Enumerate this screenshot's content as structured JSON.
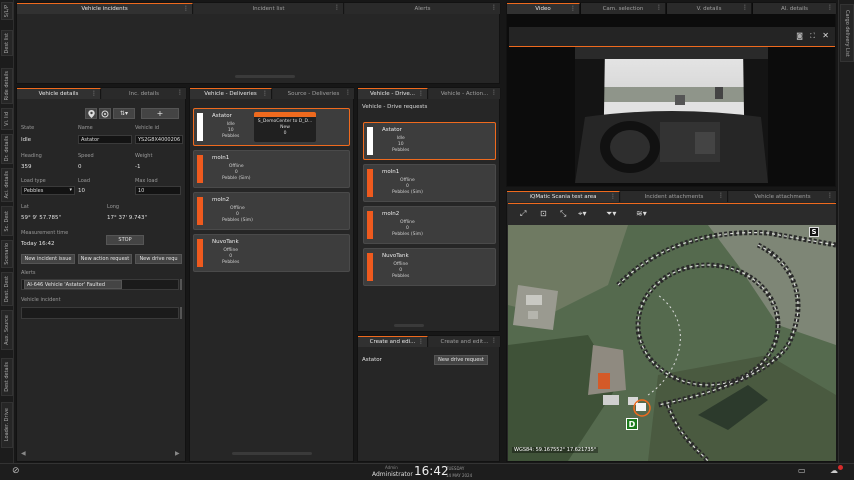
{
  "left_tabs": [
    "S/L/P",
    "Dest list",
    "Ride details",
    "Vi. lid",
    "Dr. details",
    "Aci. details",
    "Sc. Dest",
    "Scenario",
    "Dest. Dest",
    "Aux. Source",
    "Dest details",
    "Loader. Drive"
  ],
  "right_tabs": [
    "Cargo delivery List"
  ],
  "top": {
    "tab1": "Vehicle incidents",
    "tab2": "Incident list",
    "tab3": "Alerts"
  },
  "vehicle_details": {
    "tab1": "Vehicle details",
    "tab2": "Inc. details",
    "state_label": "State",
    "state": "Idle",
    "name_label": "Name",
    "name": "Astator",
    "vid_label": "Vehicle id",
    "vid": "YS2G8X4000206",
    "heading_label": "Heading",
    "heading": "359",
    "speed_label": "Speed",
    "speed": "0",
    "weight_label": "Weight",
    "weight": "-1",
    "loadtype_label": "Load type",
    "loadtype": "Pebbles",
    "load_label": "Load",
    "load": "10",
    "maxload_label": "Max load",
    "maxload": "10",
    "lat_label": "Lat",
    "lat": "59° 9' 57.785\"",
    "long_label": "Long",
    "long": "17° 37' 9.743\"",
    "mtime_label": "Measurement time",
    "mtime": "Today 16:42",
    "stop": "STOP",
    "btn_incident": "New incident issue",
    "btn_action": "New action request",
    "btn_drive": "New drive requ",
    "alerts_label": "Alerts",
    "alert_item": "AI-646 Vehicle 'Astator' Faulted",
    "incident_label": "Vehicle incident"
  },
  "deliveries": {
    "tab1": "Vehicle - Deliveries",
    "tab2": "Source - Deliveries",
    "cards": [
      {
        "name": "Astator",
        "status": "Idle",
        "num": "10",
        "cargo": "Pebbles",
        "color": "#ffffff",
        "task_title": "S_DemoCenter to D_D...",
        "task_state": "New",
        "task_num": "0"
      },
      {
        "name": "moln1",
        "status": "Offline",
        "num": "0",
        "cargo": "Pebble (Sim)",
        "color": "#ef5a1e"
      },
      {
        "name": "moln2",
        "status": "Offline",
        "num": "0",
        "cargo": "Pebbles (Sim)",
        "color": "#ef5a1e"
      },
      {
        "name": "NuvoTank",
        "status": "Offline",
        "num": "0",
        "cargo": "Pebbles",
        "color": "#ef5a1e"
      }
    ]
  },
  "drive_requests": {
    "tab1": "Vehicle - Drive...",
    "tab2": "Vehicle - Action...",
    "title": "Vehicle - Drive requests",
    "cards": [
      {
        "name": "Astator",
        "status": "Idle",
        "num": "10",
        "cargo": "Pebbles",
        "color": "#ffffff"
      },
      {
        "name": "moln1",
        "status": "Offline",
        "num": "0",
        "cargo": "Pebbles (Sim)",
        "color": "#ef5a1e"
      },
      {
        "name": "moln2",
        "status": "Offline",
        "num": "0",
        "cargo": "Pebbles (Sim)",
        "color": "#ef5a1e"
      },
      {
        "name": "NuvoTank",
        "status": "Offline",
        "num": "0",
        "cargo": "Pebbles",
        "color": "#ef5a1e"
      }
    ]
  },
  "create": {
    "tab1": "Create and edi...",
    "tab2": "Create and edit...",
    "vehicle": "Astator",
    "btn": "New drive request"
  },
  "video": {
    "tab1": "Video",
    "tab2": "Cam. selection",
    "tab3": "V. details",
    "tab4": "Al. details"
  },
  "map": {
    "tab1": "iQMatic Scania test area",
    "tab2": "Incident attachments",
    "tab3": "Vehicle attachments",
    "coords": "WGS84: 59.167552° 17.621735°",
    "marker_s": "S",
    "marker_d": "D"
  },
  "status": {
    "role": "Admin",
    "user": "Administrator",
    "time": "16:42",
    "day": "TUESDAY",
    "date": "14 MAY 2024"
  }
}
